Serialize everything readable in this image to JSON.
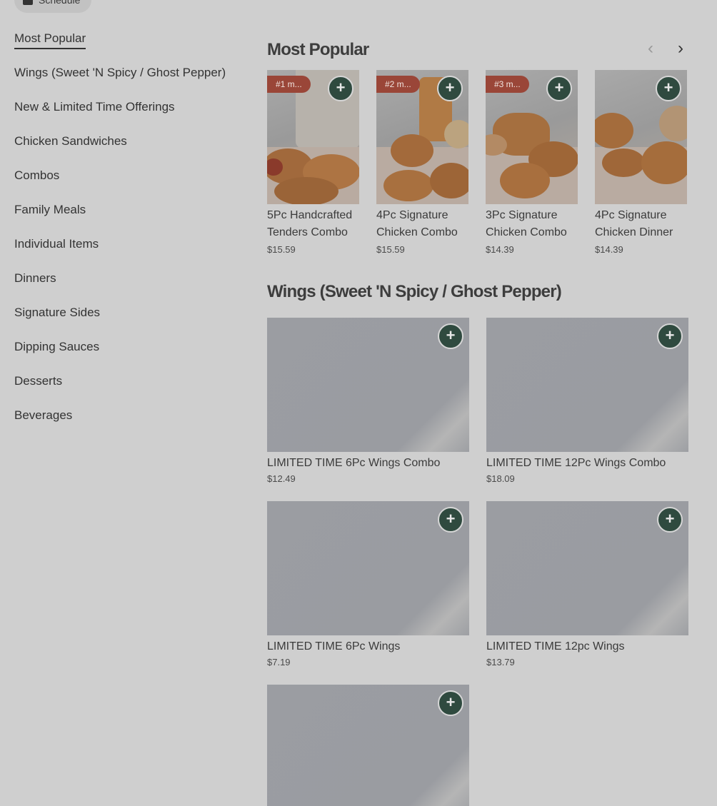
{
  "schedule": {
    "label": "Schedule"
  },
  "sidebar": {
    "items": [
      {
        "label": "Most Popular",
        "active": true
      },
      {
        "label": "Wings (Sweet 'N Spicy / Ghost Pepper)"
      },
      {
        "label": "New & Limited Time Offerings"
      },
      {
        "label": "Chicken Sandwiches"
      },
      {
        "label": "Combos"
      },
      {
        "label": "Family Meals"
      },
      {
        "label": "Individual Items"
      },
      {
        "label": "Dinners"
      },
      {
        "label": "Signature Sides"
      },
      {
        "label": "Dipping Sauces"
      },
      {
        "label": "Desserts"
      },
      {
        "label": "Beverages"
      }
    ]
  },
  "popular": {
    "title": "Most Popular",
    "prev_icon": "chevron-left-icon",
    "next_icon": "chevron-right-icon",
    "add_icon": "plus-icon",
    "items": [
      {
        "badge": "#1 m...",
        "name": "5Pc Handcrafted Tenders Combo",
        "price": "$15.59"
      },
      {
        "badge": "#2 m...",
        "name": "4Pc Signature Chicken Combo",
        "price": "$15.59"
      },
      {
        "badge": "#3 m...",
        "name": "3Pc Signature Chicken Combo",
        "price": "$14.39"
      },
      {
        "badge": "",
        "name": "4Pc Signature Chicken Dinner",
        "price": "$14.39"
      }
    ]
  },
  "wings": {
    "title": "Wings (Sweet 'N Spicy / Ghost Pepper)",
    "items": [
      {
        "name": "LIMITED TIME 6Pc Wings Combo",
        "price": "$12.49"
      },
      {
        "name": "LIMITED TIME 12Pc Wings Combo",
        "price": "$18.09"
      },
      {
        "name": "LIMITED TIME 6Pc Wings",
        "price": "$7.19"
      },
      {
        "name": "LIMITED TIME 12pc Wings",
        "price": "$13.79"
      },
      {
        "name": "",
        "price": ""
      }
    ]
  },
  "colors": {
    "overlay_background": "#cfcfcf",
    "add_button": "#2f4a3f",
    "rank_badge": "#9a4638"
  }
}
